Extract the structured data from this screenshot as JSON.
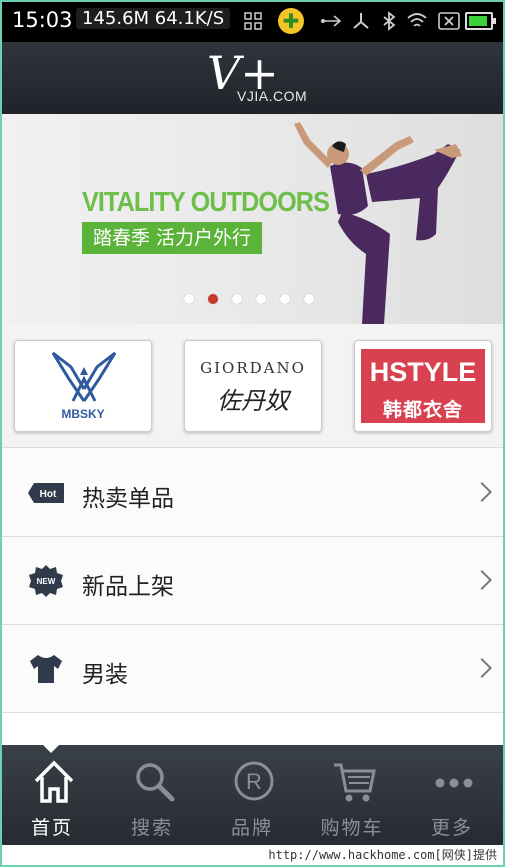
{
  "status_bar": {
    "time": "15:03",
    "speed": "145.6M 64.1K/S",
    "icons": [
      "wifi-icon",
      "grid-icon",
      "plus-icon",
      "usb-icon",
      "share-icon",
      "bluetooth-icon",
      "wifi-icon",
      "close-box-icon",
      "battery-icon"
    ]
  },
  "header": {
    "logo_mark": "V+",
    "logo_text": "VJIA.COM"
  },
  "banner": {
    "headline": "VITALITY OUTDOORS",
    "subline": "踏春季  活力户外行",
    "dot_count": 6,
    "active_dot": 2
  },
  "brands": [
    {
      "name": "MBSKY",
      "icon": "mbsky-wings-logo"
    },
    {
      "name": "GIORDANO",
      "script": "佐丹奴",
      "icon": "giordano-logo"
    },
    {
      "name": "HSTYLE",
      "cn": "韩都衣舍",
      "icon": "hstyle-logo"
    }
  ],
  "menu": [
    {
      "label": "热卖单品",
      "badge": "Hot",
      "icon": "hot-tag-icon"
    },
    {
      "label": "新品上架",
      "badge": "NEW",
      "icon": "new-badge-icon"
    },
    {
      "label": "男装",
      "icon": "tshirt-icon"
    }
  ],
  "tabs": [
    {
      "label": "首页",
      "icon": "home-icon",
      "active": true
    },
    {
      "label": "搜索",
      "icon": "search-icon",
      "active": false
    },
    {
      "label": "品牌",
      "icon": "brand-r-icon",
      "active": false
    },
    {
      "label": "购物车",
      "icon": "cart-icon",
      "active": false
    },
    {
      "label": "更多",
      "icon": "more-icon",
      "active": false
    }
  ],
  "watermark": "http://www.hackhome.com[网侠]提供",
  "colors": {
    "accent_green": "#5bb33a",
    "active_dot": "#c4392d",
    "hstyle_red": "#d84150",
    "tab_bar": "#2e343b"
  }
}
